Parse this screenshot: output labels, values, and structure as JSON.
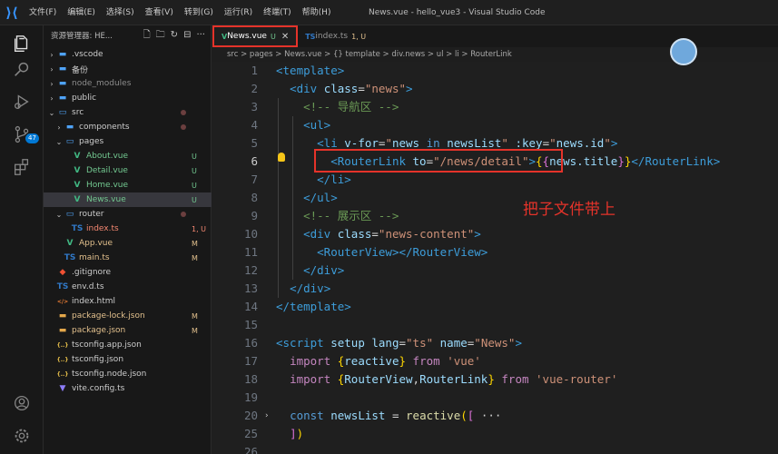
{
  "titlebar": {
    "menu": [
      "文件(F)",
      "编辑(E)",
      "选择(S)",
      "查看(V)",
      "转到(G)",
      "运行(R)",
      "终端(T)",
      "帮助(H)"
    ],
    "window_title": "News.vue - hello_vue3 - Visual Studio Code"
  },
  "activity": {
    "badge": "47"
  },
  "sidebar": {
    "header": "资源管理器: HE...",
    "items": [
      {
        "name": ".vscode",
        "type": "folder-closed",
        "status": "",
        "indent": 1
      },
      {
        "name": "备份",
        "type": "folder-closed",
        "status": "",
        "indent": 1
      },
      {
        "name": "node_modules",
        "type": "folder-closed",
        "status": "",
        "indent": 1
      },
      {
        "name": "public",
        "type": "folder-closed",
        "status": "",
        "indent": 1
      },
      {
        "name": "src",
        "type": "folder-open",
        "status": "",
        "indent": 1
      },
      {
        "name": "components",
        "type": "folder-closed",
        "status": "",
        "indent": 2
      },
      {
        "name": "pages",
        "type": "folder-open",
        "status": "",
        "indent": 2
      },
      {
        "name": "About.vue",
        "type": "vue",
        "status": "U",
        "indent": 3
      },
      {
        "name": "Detail.vue",
        "type": "vue",
        "status": "U",
        "indent": 3
      },
      {
        "name": "Home.vue",
        "type": "vue",
        "status": "U",
        "indent": 3
      },
      {
        "name": "News.vue",
        "type": "vue",
        "status": "U",
        "indent": 3
      },
      {
        "name": "router",
        "type": "folder-open",
        "status": "",
        "indent": 2
      },
      {
        "name": "index.ts",
        "type": "ts",
        "status": "1, U",
        "indent": 3
      },
      {
        "name": "App.vue",
        "type": "vue",
        "status": "M",
        "indent": 2
      },
      {
        "name": "main.ts",
        "type": "ts",
        "status": "M",
        "indent": 2
      },
      {
        "name": ".gitignore",
        "type": "git",
        "status": "",
        "indent": 1
      },
      {
        "name": "env.d.ts",
        "type": "ts",
        "status": "",
        "indent": 1
      },
      {
        "name": "index.html",
        "type": "html",
        "status": "",
        "indent": 1
      },
      {
        "name": "package-lock.json",
        "type": "json",
        "status": "M",
        "indent": 1
      },
      {
        "name": "package.json",
        "type": "json",
        "status": "M",
        "indent": 1
      },
      {
        "name": "tsconfig.app.json",
        "type": "cfg",
        "status": "",
        "indent": 1
      },
      {
        "name": "tsconfig.json",
        "type": "cfg",
        "status": "",
        "indent": 1
      },
      {
        "name": "tsconfig.node.json",
        "type": "cfg",
        "status": "",
        "indent": 1
      },
      {
        "name": "vite.config.ts",
        "type": "vite",
        "status": "",
        "indent": 1
      }
    ]
  },
  "tabs": [
    {
      "label": "News.vue",
      "mod": "U",
      "active": true
    },
    {
      "label": "index.ts",
      "mod": "1, U",
      "active": false
    }
  ],
  "breadcrumb": "src > pages > News.vue > {} template > div.news > ul > li > RouterLink",
  "editor": {
    "lines": [
      {
        "n": "1",
        "tokens": [
          [
            "t-tag",
            "<template>"
          ]
        ]
      },
      {
        "n": "2",
        "tokens": [
          [
            "t-pl",
            "  "
          ],
          [
            "t-tag",
            "<div "
          ],
          [
            "t-attr",
            "class"
          ],
          [
            "t-pl",
            "="
          ],
          [
            "t-str",
            "\"news\""
          ],
          [
            "t-tag",
            ">"
          ]
        ]
      },
      {
        "n": "3",
        "tokens": [
          [
            "t-pl",
            "    "
          ],
          [
            "t-com",
            "<!-- 导航区 -->"
          ]
        ]
      },
      {
        "n": "4",
        "tokens": [
          [
            "t-pl",
            "    "
          ],
          [
            "t-tag",
            "<ul>"
          ]
        ]
      },
      {
        "n": "5",
        "tokens": [
          [
            "t-pl",
            "      "
          ],
          [
            "t-tag",
            "<li "
          ],
          [
            "t-attr",
            "v-for"
          ],
          [
            "t-pl",
            "="
          ],
          [
            "t-str",
            "\""
          ],
          [
            "t-var",
            "news"
          ],
          [
            "t-kw",
            " in "
          ],
          [
            "t-var",
            "newsList"
          ],
          [
            "t-str",
            "\""
          ],
          [
            "t-pl",
            " "
          ],
          [
            "t-attr",
            ":key"
          ],
          [
            "t-pl",
            "="
          ],
          [
            "t-str",
            "\""
          ],
          [
            "t-var",
            "news.id"
          ],
          [
            "t-str",
            "\""
          ],
          [
            "t-tag",
            ">"
          ]
        ]
      },
      {
        "n": "6",
        "tokens": [
          [
            "t-pl",
            "        "
          ],
          [
            "t-tag",
            "<RouterLink "
          ],
          [
            "t-attr",
            "to"
          ],
          [
            "t-pl",
            "="
          ],
          [
            "t-str",
            "\"/news/detail\""
          ],
          [
            "t-tag",
            ">"
          ],
          [
            "t-brk",
            "{"
          ],
          [
            "t-brk2",
            "{"
          ],
          [
            "t-var",
            "news.title"
          ],
          [
            "t-brk2",
            "}"
          ],
          [
            "t-brk",
            "}"
          ],
          [
            "t-tag",
            "</RouterLink>"
          ]
        ]
      },
      {
        "n": "7",
        "tokens": [
          [
            "t-pl",
            "      "
          ],
          [
            "t-tag",
            "</li>"
          ]
        ]
      },
      {
        "n": "8",
        "tokens": [
          [
            "t-pl",
            "    "
          ],
          [
            "t-tag",
            "</ul>"
          ]
        ]
      },
      {
        "n": "9",
        "tokens": [
          [
            "t-pl",
            "    "
          ],
          [
            "t-com",
            "<!-- 展示区 -->"
          ]
        ]
      },
      {
        "n": "10",
        "tokens": [
          [
            "t-pl",
            "    "
          ],
          [
            "t-tag",
            "<div "
          ],
          [
            "t-attr",
            "class"
          ],
          [
            "t-pl",
            "="
          ],
          [
            "t-str",
            "\"news-content\""
          ],
          [
            "t-tag",
            ">"
          ]
        ]
      },
      {
        "n": "11",
        "tokens": [
          [
            "t-pl",
            "      "
          ],
          [
            "t-tag",
            "<RouterView></RouterView>"
          ]
        ]
      },
      {
        "n": "12",
        "tokens": [
          [
            "t-pl",
            "    "
          ],
          [
            "t-tag",
            "</div>"
          ]
        ]
      },
      {
        "n": "13",
        "tokens": [
          [
            "t-pl",
            "  "
          ],
          [
            "t-tag",
            "</div>"
          ]
        ]
      },
      {
        "n": "14",
        "tokens": [
          [
            "t-tag",
            "</template>"
          ]
        ]
      },
      {
        "n": "15",
        "tokens": []
      },
      {
        "n": "16",
        "tokens": [
          [
            "t-tag",
            "<script "
          ],
          [
            "t-attr",
            "setup "
          ],
          [
            "t-attr",
            "lang"
          ],
          [
            "t-pl",
            "="
          ],
          [
            "t-str",
            "\"ts\""
          ],
          [
            "t-pl",
            " "
          ],
          [
            "t-attr",
            "name"
          ],
          [
            "t-pl",
            "="
          ],
          [
            "t-str",
            "\"News\""
          ],
          [
            "t-tag",
            ">"
          ]
        ]
      },
      {
        "n": "17",
        "tokens": [
          [
            "t-pl",
            "  "
          ],
          [
            "t-imp",
            "import "
          ],
          [
            "t-brk",
            "{"
          ],
          [
            "t-var",
            "reactive"
          ],
          [
            "t-brk",
            "}"
          ],
          [
            "t-imp",
            " from "
          ],
          [
            "t-str",
            "'vue'"
          ]
        ]
      },
      {
        "n": "18",
        "tokens": [
          [
            "t-pl",
            "  "
          ],
          [
            "t-imp",
            "import "
          ],
          [
            "t-brk",
            "{"
          ],
          [
            "t-var",
            "RouterView"
          ],
          [
            "t-pl",
            ","
          ],
          [
            "t-var",
            "RouterLink"
          ],
          [
            "t-brk",
            "}"
          ],
          [
            "t-imp",
            " from "
          ],
          [
            "t-str",
            "'vue-router'"
          ]
        ]
      },
      {
        "n": "19",
        "tokens": []
      },
      {
        "n": "20",
        "tokens": [
          [
            "t-pl",
            "  "
          ],
          [
            "t-kw",
            "const "
          ],
          [
            "t-var",
            "newsList"
          ],
          [
            "t-pl",
            " = "
          ],
          [
            "t-fn",
            "reactive"
          ],
          [
            "t-brk",
            "("
          ],
          [
            "t-brk2",
            "["
          ],
          [
            "t-pl",
            " ···"
          ]
        ]
      },
      {
        "n": "25",
        "tokens": [
          [
            "t-pl",
            "  "
          ],
          [
            "t-brk2",
            "]"
          ],
          [
            "t-brk",
            ")"
          ]
        ]
      },
      {
        "n": "26",
        "tokens": []
      }
    ]
  },
  "annotation": "把子文件带上"
}
